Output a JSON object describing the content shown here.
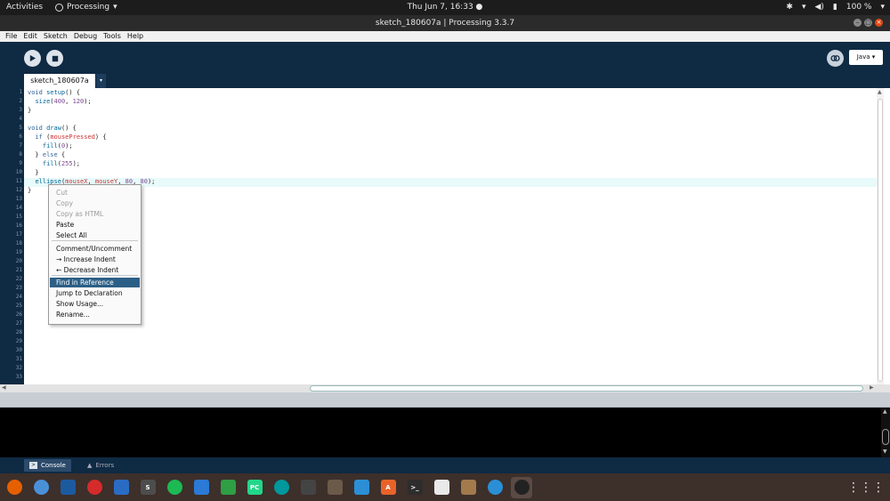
{
  "topbar": {
    "activities": "Activities",
    "app_name": "Processing",
    "clock": "Thu Jun  7, 16:33 ●",
    "battery": "100 %"
  },
  "window": {
    "title": "sketch_180607a | Processing 3.3.7"
  },
  "menubar": {
    "items": [
      "File",
      "Edit",
      "Sketch",
      "Debug",
      "Tools",
      "Help"
    ]
  },
  "toolbar": {
    "mode": "Java ▾"
  },
  "tab": {
    "name": "sketch_180607a",
    "menu_arrow": "▾"
  },
  "editor": {
    "line_numbers": [
      "1",
      "2",
      "3",
      "4",
      "5",
      "6",
      "7",
      "8",
      "9",
      "10",
      "11",
      "12",
      "13",
      "14",
      "15",
      "16",
      "17",
      "18",
      "19",
      "20",
      "21",
      "22",
      "23",
      "24",
      "25",
      "26",
      "27",
      "28",
      "29",
      "30",
      "31",
      "32",
      "33"
    ],
    "lines": [
      "void setup() {",
      "  size(400, 120);",
      "}",
      "",
      "void draw() {",
      "  if (mousePressed) {",
      "    fill(0);",
      "  } else {",
      "    fill(255);",
      "  }",
      "  ellipse(mouseX, mouseY, 80, 80);",
      "}"
    ],
    "current_line": 11
  },
  "context_menu": {
    "items": [
      {
        "label": "Cut",
        "enabled": false
      },
      {
        "label": "Copy",
        "enabled": false
      },
      {
        "label": "Copy as HTML",
        "enabled": false
      },
      {
        "label": "Paste",
        "enabled": true
      },
      {
        "label": "Select All",
        "enabled": true
      },
      {
        "label": "Comment/Uncomment",
        "enabled": true
      },
      {
        "label": "→ Increase Indent",
        "enabled": true
      },
      {
        "label": "← Decrease Indent",
        "enabled": true
      },
      {
        "label": "Find in Reference",
        "enabled": true,
        "selected": true
      },
      {
        "label": "Jump to Declaration",
        "enabled": true
      },
      {
        "label": "Show Usage...",
        "enabled": true
      },
      {
        "label": "Rename...",
        "enabled": true
      }
    ]
  },
  "status_tabs": {
    "console": "Console",
    "errors": "Errors"
  },
  "dock": {
    "apps": [
      "firefox-icon",
      "chromium-icon",
      "virtualbox-icon",
      "vivaldi-icon",
      "thunderbird-icon",
      "sublime-icon",
      "spotify-icon",
      "writer-icon",
      "calc-icon",
      "pycharm-icon",
      "arduino-icon",
      "inkscape-icon",
      "gimp-icon",
      "vscode-icon",
      "software-center-icon",
      "terminal-icon",
      "files-icon",
      "archive-icon",
      "timeshift-icon",
      "processing-icon"
    ],
    "glyph_texts": {
      "sublime-icon": "S",
      "pycharm-icon": "PC",
      "software-center-icon": "A",
      "terminal-icon": ">_"
    }
  },
  "colors": {
    "processing_navy": "#0f2a43",
    "selection_blue": "#2c5f86",
    "keyword_blue": "#33669a",
    "function_teal": "#006699",
    "number_red": "#7d4793"
  }
}
